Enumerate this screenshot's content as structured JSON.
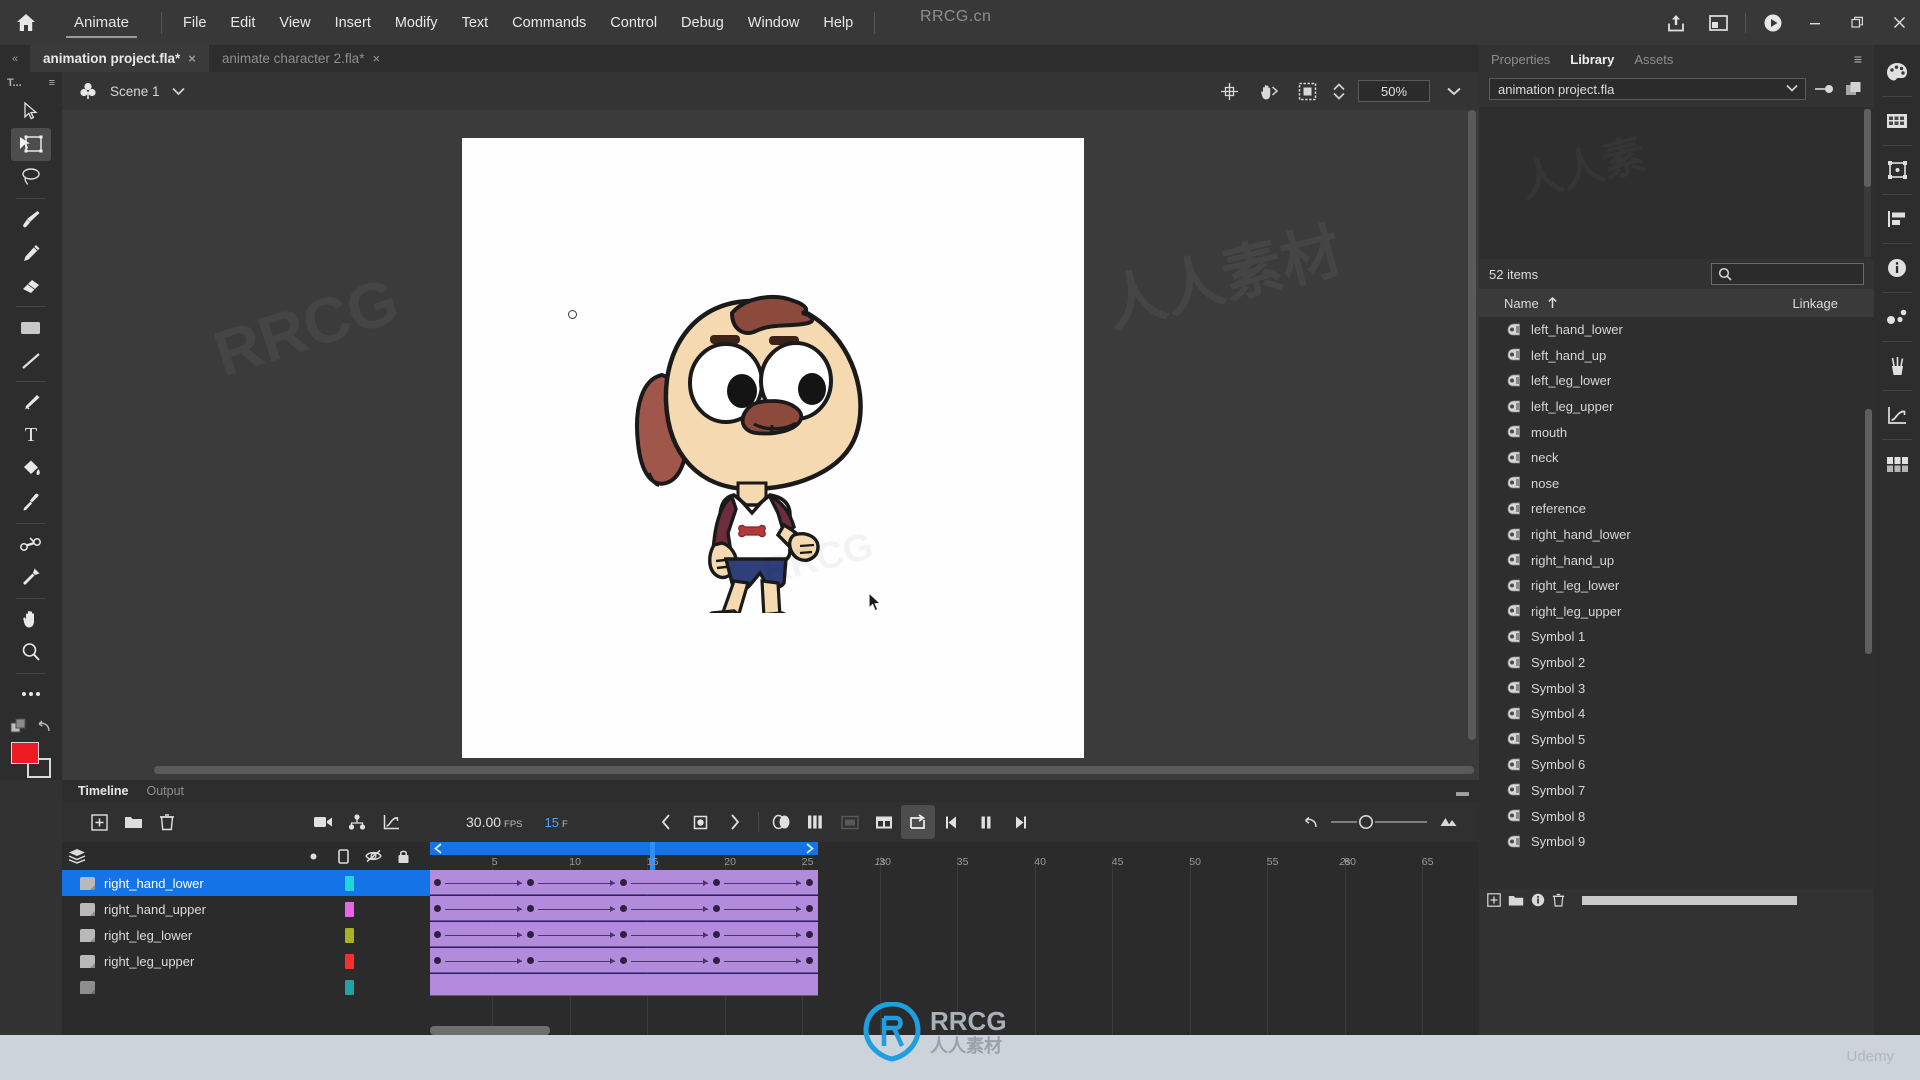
{
  "app": {
    "name": "Animate",
    "watermark_title": "RRCG.cn",
    "home_icon": "home-icon"
  },
  "menubar": {
    "items": [
      "File",
      "Edit",
      "View",
      "Insert",
      "Modify",
      "Text",
      "Commands",
      "Control",
      "Debug",
      "Window",
      "Help"
    ],
    "right_icons": [
      "share-icon",
      "workspace-layout-icon",
      "play-preview-icon"
    ],
    "window_controls": [
      "minimize",
      "restore",
      "close"
    ]
  },
  "document_tabs": [
    {
      "label": "animation project.fla*",
      "active": true,
      "close": "×"
    },
    {
      "label": "animate character 2.fla*",
      "active": false,
      "close": "×"
    }
  ],
  "toolbar": {
    "title": "T...",
    "menu_icon": "panel-menu-icon",
    "tools": [
      {
        "name": "selection-tool",
        "icon": "arrow-cursor-icon",
        "selected": false
      },
      {
        "name": "free-transform-tool",
        "icon": "free-transform-icon",
        "selected": true
      },
      {
        "name": "lasso-tool",
        "icon": "lasso-icon",
        "selected": false
      },
      {
        "name": "brush-tool",
        "icon": "paintbrush-icon",
        "selected": false
      },
      {
        "name": "pencil-tool",
        "icon": "pencil-icon",
        "selected": false
      },
      {
        "name": "eraser-tool",
        "icon": "eraser-icon",
        "selected": false
      },
      {
        "name": "rectangle-tool",
        "icon": "rectangle-icon",
        "selected": false
      },
      {
        "name": "line-tool",
        "icon": "line-icon",
        "selected": false
      },
      {
        "name": "pen-tool",
        "icon": "pen-icon",
        "selected": false
      },
      {
        "name": "text-tool",
        "icon": "text-t-icon",
        "selected": false
      },
      {
        "name": "paint-bucket-tool",
        "icon": "paint-bucket-icon",
        "selected": false
      },
      {
        "name": "eyedropper-tool",
        "icon": "eyedropper-icon",
        "selected": false
      },
      {
        "name": "bone-tool",
        "icon": "bone-icon",
        "selected": false
      },
      {
        "name": "width-tool",
        "icon": "width-pin-icon",
        "selected": false
      },
      {
        "name": "hand-tool",
        "icon": "hand-icon",
        "selected": false
      },
      {
        "name": "zoom-tool",
        "icon": "magnifier-icon",
        "selected": false
      },
      {
        "name": "more-tools",
        "icon": "ellipsis-icon",
        "selected": false
      }
    ],
    "colors": {
      "fill": "#ed1c24",
      "stroke": "#ffffff"
    }
  },
  "editbar": {
    "scene_icon": "scene-clover-icon",
    "scene_name": "Scene 1",
    "scene_dropdown": "chevron-down-icon",
    "right_icons": [
      "center-stage-icon",
      "rotate-stage-icon",
      "clip-content-icon"
    ],
    "zoom_value": "50%",
    "zoom_dropdown": "chevron-down-icon"
  },
  "stage": {
    "character": "walking-dog-character",
    "cursor": "mouse-pointer",
    "transform_point": "transform-origin-dot",
    "colors": {
      "skin": "#f5d9b0",
      "ear": "#a0564a",
      "hair": "#8c4a3c",
      "shirt": "#ffffff",
      "sleeve": "#6e2d3c",
      "shorts": "#2f3f7a",
      "outline": "#1a1a1a"
    }
  },
  "timeline": {
    "tabs": [
      {
        "label": "Timeline",
        "active": true
      },
      {
        "label": "Output",
        "active": false
      }
    ],
    "collapse_icon": "collapse-icon",
    "left_tools": [
      "new-layer-icon",
      "new-folder-icon",
      "delete-layer-icon"
    ],
    "mid_tools": [
      "camera-icon",
      "layer-parenting-icon",
      "graph-editor-icon"
    ],
    "fps": "30.00",
    "fps_label": "FPS",
    "current_frame": "15",
    "frame_label": "F",
    "playback": [
      "previous-keyframe-icon",
      "insert-keyframe-icon",
      "next-keyframe-icon",
      "onion-skin-icon",
      "onion-skin-outline-icon",
      "edit-multiple-frames-icon",
      "modify-onion-markers-icon",
      "loop-playback-icon",
      "step-back-icon",
      "pause-icon",
      "step-forward-icon"
    ],
    "right_tools": [
      "reset-icon",
      "frame-size-slider",
      "resize-icon"
    ],
    "layer_header_icons": [
      "layer-stack-icon",
      "dot-icon",
      "outline-icon",
      "eye-hidden-icon",
      "lock-icon"
    ],
    "layers": [
      {
        "name": "right_hand_lower",
        "color": "#1fd7d7",
        "selected": true
      },
      {
        "name": "right_hand_upper",
        "color": "#e966e9",
        "selected": false
      },
      {
        "name": "right_leg_lower",
        "color": "#a8b321",
        "selected": false
      },
      {
        "name": "right_leg_upper",
        "color": "#ff2d2d",
        "selected": false
      },
      {
        "name": "",
        "color": "#1fd7d7",
        "selected": false
      }
    ],
    "ruler": {
      "numbers": [
        "5",
        "10",
        "15",
        "20",
        "25",
        "30",
        "35",
        "40",
        "45",
        "50",
        "55",
        "60",
        "65"
      ],
      "seconds": [
        "1s",
        "2s"
      ],
      "playhead_frame": "15",
      "span_start_frame": "1",
      "span_end_frame": "25"
    },
    "keyframes": [
      1,
      7,
      13,
      19,
      25
    ],
    "tween_color": "#b38bdc"
  },
  "right_panel": {
    "tabs": [
      {
        "label": "Properties",
        "active": false
      },
      {
        "label": "Library",
        "active": true
      },
      {
        "label": "Assets",
        "active": false
      }
    ],
    "panel_menu_icon": "panel-menu-icon",
    "document_selector": "animation project.fla",
    "document_dropdown": "chevron-down-icon",
    "pin_icon": "pin-library-icon",
    "new_library_icon": "new-library-panel-icon",
    "item_count": "52 items",
    "search_icon": "search-icon",
    "search_placeholder": "",
    "columns": {
      "name": "Name",
      "sort": "sort-ascending-icon",
      "linkage": "Linkage"
    },
    "items": [
      "left_hand_lower",
      "left_hand_up",
      "left_leg_lower",
      "left_leg_upper",
      "mouth",
      "neck",
      "nose",
      "reference",
      "right_hand_lower",
      "right_hand_up",
      "right_leg_lower",
      "right_leg_upper",
      "Symbol 1",
      "Symbol 2",
      "Symbol 3",
      "Symbol 4",
      "Symbol 5",
      "Symbol 6",
      "Symbol 7",
      "Symbol 8",
      "Symbol 9"
    ],
    "item_icon": "movie-clip-symbol-icon",
    "footer_icons": [
      "new-symbol-icon",
      "new-folder-icon",
      "properties-icon",
      "delete-icon"
    ]
  },
  "dock": {
    "icons": [
      "color-palette-icon",
      "swatches-icon",
      "transform-icon",
      "align-icon",
      "info-icon",
      "motion-editor-icon",
      "brush-library-icon",
      "graph-icon",
      "frame-picker-icon"
    ]
  },
  "desktop": {
    "udemy_watermark": "Udemy",
    "rrcg_watermark": "RRCG",
    "rrcg_sub": "人人素材"
  }
}
